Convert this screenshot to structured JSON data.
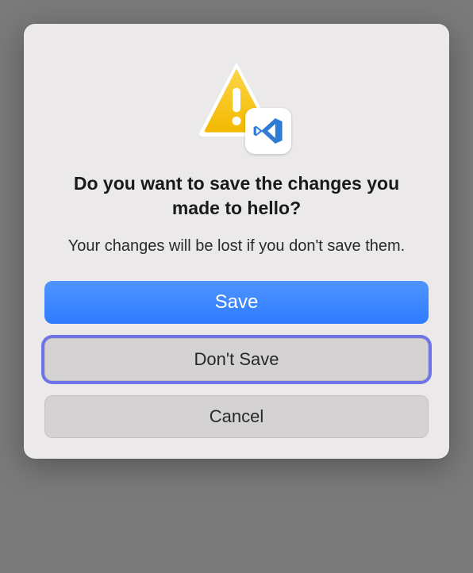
{
  "dialog": {
    "title": "Do you want to save the changes you made to hello?",
    "message": "Your changes will be lost if you don't save them.",
    "buttons": {
      "save": "Save",
      "dont_save": "Don't Save",
      "cancel": "Cancel"
    },
    "icons": {
      "warning": "warning-icon",
      "app": "vscode-icon"
    }
  }
}
